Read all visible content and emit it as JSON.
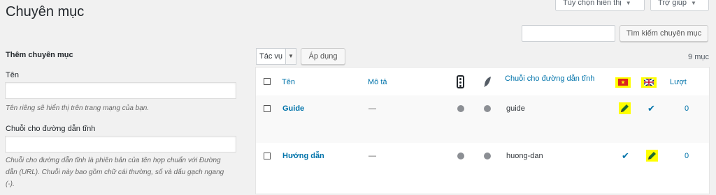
{
  "screen_options": "Tùy chọn hiển thị",
  "help": "Trợ giúp",
  "page_title": "Chuyên mục",
  "search": {
    "button": "Tìm kiếm chuyên mục",
    "value": ""
  },
  "add_form": {
    "heading": "Thêm chuyên mục",
    "name_label": "Tên",
    "name_hint": "Tên riêng sẽ hiển thị trên trang mạng của bạn.",
    "slug_label": "Chuỗi cho đường dẫn tĩnh",
    "slug_hint_1": "Chuỗi cho đường dẫn tĩnh là phiên bản của tên hợp chuẩn với Đường",
    "slug_hint_2": "dẫn (URL). Chuỗi này bao gồm chữ cái thường, số và dấu gạch ngang",
    "slug_hint_3": "(-)."
  },
  "bulk": {
    "selected": "Tác vụ",
    "apply": "Áp dụng"
  },
  "item_count": "9 mục",
  "columns": {
    "name": "Tên",
    "description": "Mô tả",
    "slug": "Chuỗi cho đường dẫn tĩnh",
    "count": "Lượt"
  },
  "rows": [
    {
      "name": "Guide",
      "description": "—",
      "slug": "guide",
      "count": "0"
    },
    {
      "name": "Hướng dẫn",
      "description": "—",
      "slug": "huong-dan",
      "count": "0"
    }
  ],
  "colors": {
    "link": "#0073aa",
    "highlight": "#ffff00",
    "vn_flag": "#da251d",
    "star": "#ffff00"
  }
}
